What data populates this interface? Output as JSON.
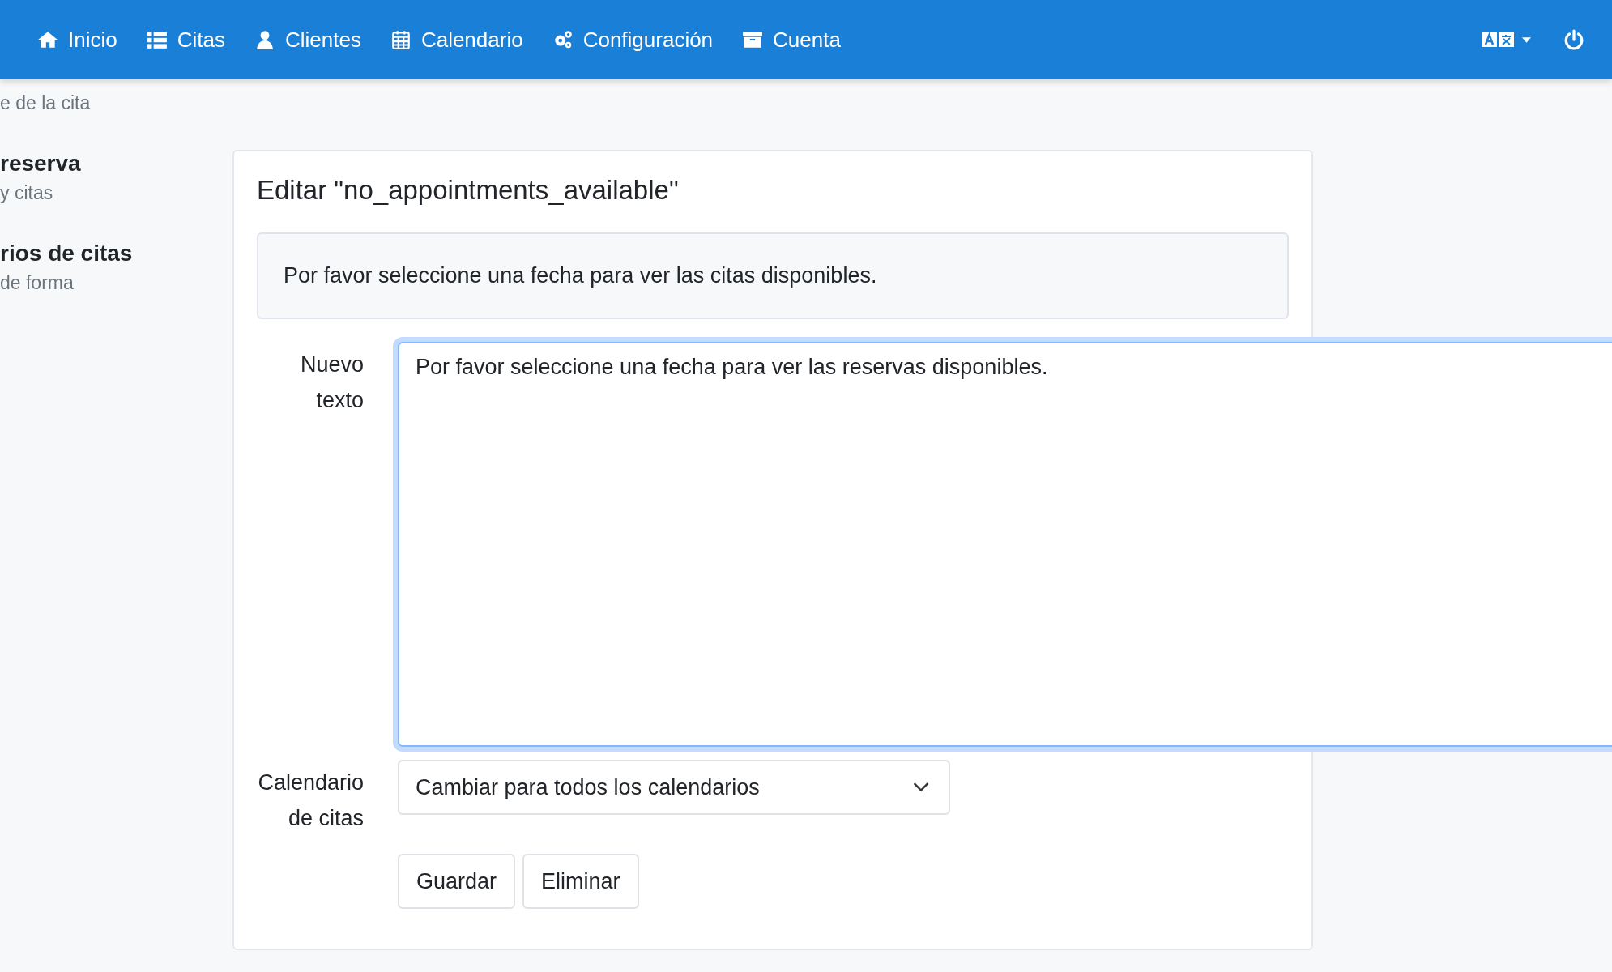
{
  "nav": {
    "items": [
      {
        "label": "Inicio"
      },
      {
        "label": "Citas"
      },
      {
        "label": "Clientes"
      },
      {
        "label": "Calendario"
      },
      {
        "label": "Configuración"
      },
      {
        "label": "Cuenta"
      }
    ]
  },
  "sidebar": {
    "items": [
      {
        "subtitle": "e de la cita"
      },
      {
        "title": "reserva",
        "subtitle": "y citas"
      },
      {
        "title": "rios de citas",
        "subtitle": "de forma"
      }
    ]
  },
  "card": {
    "title": "Editar \"no_appointments_available\"",
    "original_text": "Por favor seleccione una fecha para ver las citas disponibles.",
    "new_text": {
      "label": "Nuevo texto",
      "value": "Por favor seleccione una fecha para ver las reservas disponibles."
    },
    "calendar": {
      "label": "Calendario de citas",
      "value": "Cambiar para todos los calendarios"
    },
    "buttons": [
      "Guardar",
      "Eliminar"
    ]
  }
}
